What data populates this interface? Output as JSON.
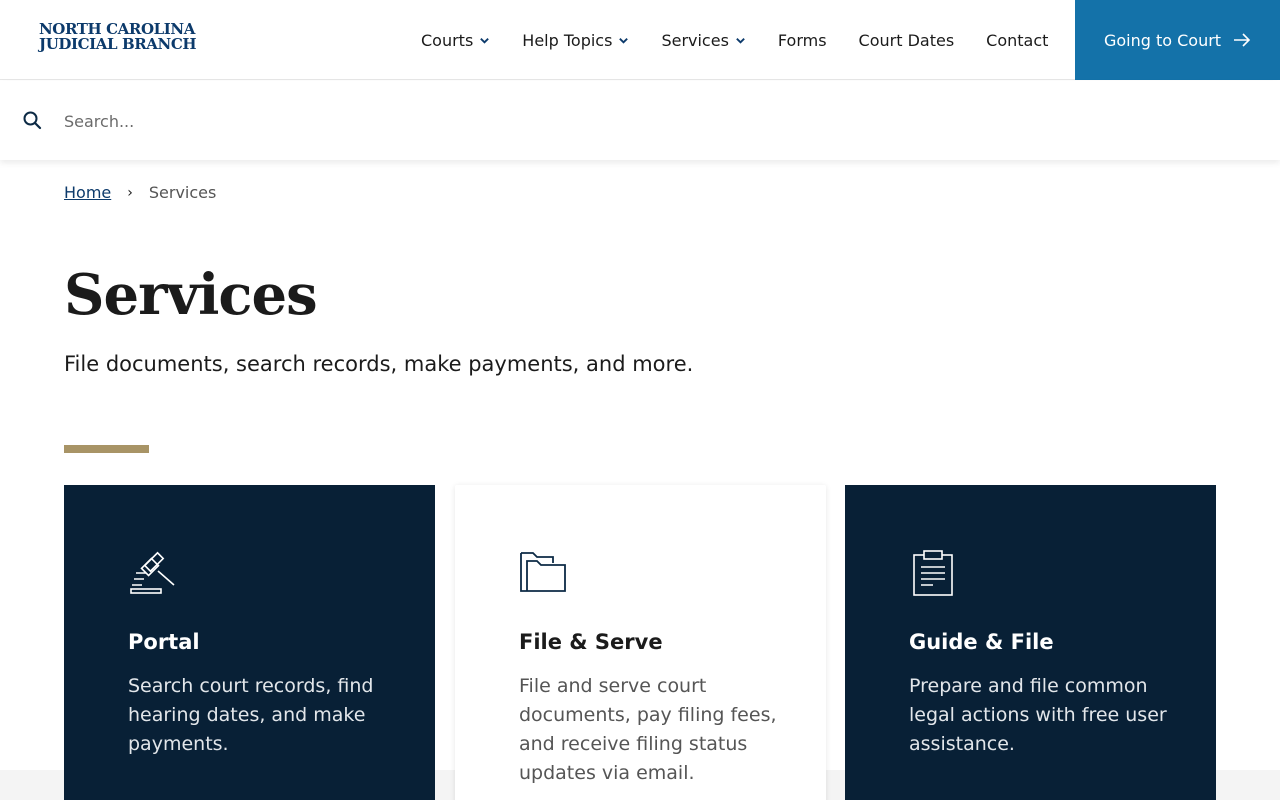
{
  "logo": {
    "line1": "NORTH CAROLINA",
    "line2": "JUDICIAL BRANCH"
  },
  "nav": {
    "items": [
      {
        "label": "Courts",
        "dropdown": true
      },
      {
        "label": "Help Topics",
        "dropdown": true
      },
      {
        "label": "Services",
        "dropdown": true
      },
      {
        "label": "Forms",
        "dropdown": false
      },
      {
        "label": "Court Dates",
        "dropdown": false
      },
      {
        "label": "Contact",
        "dropdown": false
      }
    ],
    "cta_label": "Going to Court"
  },
  "search": {
    "placeholder": "Search..."
  },
  "breadcrumb": {
    "home": "Home",
    "separator": "›",
    "current": "Services"
  },
  "page": {
    "title": "Services",
    "subtitle": "File documents, search records, make payments, and more."
  },
  "cards": [
    {
      "title": "Portal",
      "description": "Search court records, find hearing dates, and make payments.",
      "icon": "gavel-icon"
    },
    {
      "title": "File & Serve",
      "description": "File and serve court documents, pay filing fees, and receive filing status updates via email.",
      "icon": "folder-icon"
    },
    {
      "title": "Guide & File",
      "description": "Prepare and file common legal actions with free user assistance.",
      "icon": "clipboard-icon"
    }
  ],
  "colors": {
    "brand_navy": "#0c3a6b",
    "cta_blue": "#1472a9",
    "card_dark": "#082036",
    "accent_gold": "#a89466"
  }
}
